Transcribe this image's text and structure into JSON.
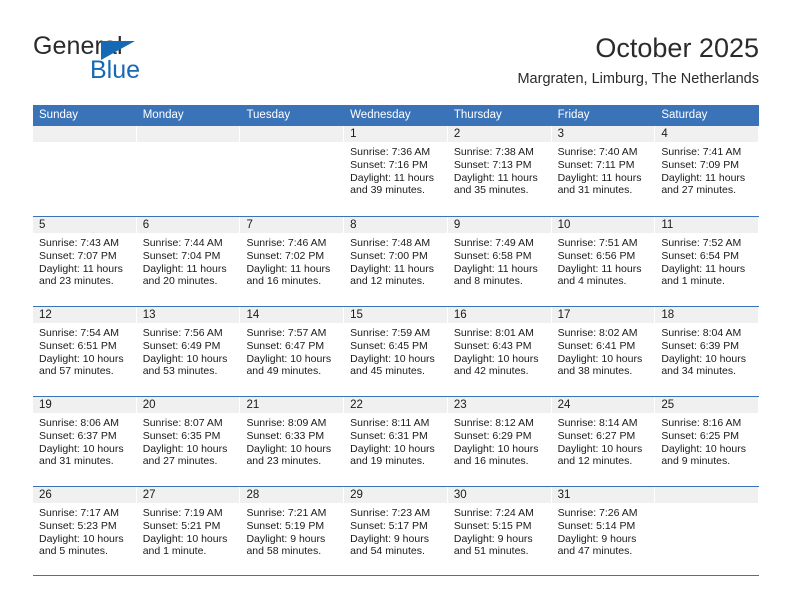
{
  "brand": {
    "word_one": "General",
    "word_two": "Blue",
    "triangle_color": "#1669b5"
  },
  "header": {
    "title": "October 2025",
    "subtitle": "Margraten, Limburg, The Netherlands"
  },
  "theme": {
    "header_blue": "#3b73b9",
    "daynum_band": "#f0f0f0",
    "text": "#1a1a1a"
  },
  "calendar": {
    "weekdays": [
      "Sunday",
      "Monday",
      "Tuesday",
      "Wednesday",
      "Thursday",
      "Friday",
      "Saturday"
    ],
    "weeks": [
      [
        {
          "day": "",
          "sunrise": "",
          "sunset": "",
          "daylight_1": "",
          "daylight_2": ""
        },
        {
          "day": "",
          "sunrise": "",
          "sunset": "",
          "daylight_1": "",
          "daylight_2": ""
        },
        {
          "day": "",
          "sunrise": "",
          "sunset": "",
          "daylight_1": "",
          "daylight_2": ""
        },
        {
          "day": "1",
          "sunrise": "Sunrise: 7:36 AM",
          "sunset": "Sunset: 7:16 PM",
          "daylight_1": "Daylight: 11 hours",
          "daylight_2": "and 39 minutes."
        },
        {
          "day": "2",
          "sunrise": "Sunrise: 7:38 AM",
          "sunset": "Sunset: 7:13 PM",
          "daylight_1": "Daylight: 11 hours",
          "daylight_2": "and 35 minutes."
        },
        {
          "day": "3",
          "sunrise": "Sunrise: 7:40 AM",
          "sunset": "Sunset: 7:11 PM",
          "daylight_1": "Daylight: 11 hours",
          "daylight_2": "and 31 minutes."
        },
        {
          "day": "4",
          "sunrise": "Sunrise: 7:41 AM",
          "sunset": "Sunset: 7:09 PM",
          "daylight_1": "Daylight: 11 hours",
          "daylight_2": "and 27 minutes."
        }
      ],
      [
        {
          "day": "5",
          "sunrise": "Sunrise: 7:43 AM",
          "sunset": "Sunset: 7:07 PM",
          "daylight_1": "Daylight: 11 hours",
          "daylight_2": "and 23 minutes."
        },
        {
          "day": "6",
          "sunrise": "Sunrise: 7:44 AM",
          "sunset": "Sunset: 7:04 PM",
          "daylight_1": "Daylight: 11 hours",
          "daylight_2": "and 20 minutes."
        },
        {
          "day": "7",
          "sunrise": "Sunrise: 7:46 AM",
          "sunset": "Sunset: 7:02 PM",
          "daylight_1": "Daylight: 11 hours",
          "daylight_2": "and 16 minutes."
        },
        {
          "day": "8",
          "sunrise": "Sunrise: 7:48 AM",
          "sunset": "Sunset: 7:00 PM",
          "daylight_1": "Daylight: 11 hours",
          "daylight_2": "and 12 minutes."
        },
        {
          "day": "9",
          "sunrise": "Sunrise: 7:49 AM",
          "sunset": "Sunset: 6:58 PM",
          "daylight_1": "Daylight: 11 hours",
          "daylight_2": "and 8 minutes."
        },
        {
          "day": "10",
          "sunrise": "Sunrise: 7:51 AM",
          "sunset": "Sunset: 6:56 PM",
          "daylight_1": "Daylight: 11 hours",
          "daylight_2": "and 4 minutes."
        },
        {
          "day": "11",
          "sunrise": "Sunrise: 7:52 AM",
          "sunset": "Sunset: 6:54 PM",
          "daylight_1": "Daylight: 11 hours",
          "daylight_2": "and 1 minute."
        }
      ],
      [
        {
          "day": "12",
          "sunrise": "Sunrise: 7:54 AM",
          "sunset": "Sunset: 6:51 PM",
          "daylight_1": "Daylight: 10 hours",
          "daylight_2": "and 57 minutes."
        },
        {
          "day": "13",
          "sunrise": "Sunrise: 7:56 AM",
          "sunset": "Sunset: 6:49 PM",
          "daylight_1": "Daylight: 10 hours",
          "daylight_2": "and 53 minutes."
        },
        {
          "day": "14",
          "sunrise": "Sunrise: 7:57 AM",
          "sunset": "Sunset: 6:47 PM",
          "daylight_1": "Daylight: 10 hours",
          "daylight_2": "and 49 minutes."
        },
        {
          "day": "15",
          "sunrise": "Sunrise: 7:59 AM",
          "sunset": "Sunset: 6:45 PM",
          "daylight_1": "Daylight: 10 hours",
          "daylight_2": "and 45 minutes."
        },
        {
          "day": "16",
          "sunrise": "Sunrise: 8:01 AM",
          "sunset": "Sunset: 6:43 PM",
          "daylight_1": "Daylight: 10 hours",
          "daylight_2": "and 42 minutes."
        },
        {
          "day": "17",
          "sunrise": "Sunrise: 8:02 AM",
          "sunset": "Sunset: 6:41 PM",
          "daylight_1": "Daylight: 10 hours",
          "daylight_2": "and 38 minutes."
        },
        {
          "day": "18",
          "sunrise": "Sunrise: 8:04 AM",
          "sunset": "Sunset: 6:39 PM",
          "daylight_1": "Daylight: 10 hours",
          "daylight_2": "and 34 minutes."
        }
      ],
      [
        {
          "day": "19",
          "sunrise": "Sunrise: 8:06 AM",
          "sunset": "Sunset: 6:37 PM",
          "daylight_1": "Daylight: 10 hours",
          "daylight_2": "and 31 minutes."
        },
        {
          "day": "20",
          "sunrise": "Sunrise: 8:07 AM",
          "sunset": "Sunset: 6:35 PM",
          "daylight_1": "Daylight: 10 hours",
          "daylight_2": "and 27 minutes."
        },
        {
          "day": "21",
          "sunrise": "Sunrise: 8:09 AM",
          "sunset": "Sunset: 6:33 PM",
          "daylight_1": "Daylight: 10 hours",
          "daylight_2": "and 23 minutes."
        },
        {
          "day": "22",
          "sunrise": "Sunrise: 8:11 AM",
          "sunset": "Sunset: 6:31 PM",
          "daylight_1": "Daylight: 10 hours",
          "daylight_2": "and 19 minutes."
        },
        {
          "day": "23",
          "sunrise": "Sunrise: 8:12 AM",
          "sunset": "Sunset: 6:29 PM",
          "daylight_1": "Daylight: 10 hours",
          "daylight_2": "and 16 minutes."
        },
        {
          "day": "24",
          "sunrise": "Sunrise: 8:14 AM",
          "sunset": "Sunset: 6:27 PM",
          "daylight_1": "Daylight: 10 hours",
          "daylight_2": "and 12 minutes."
        },
        {
          "day": "25",
          "sunrise": "Sunrise: 8:16 AM",
          "sunset": "Sunset: 6:25 PM",
          "daylight_1": "Daylight: 10 hours",
          "daylight_2": "and 9 minutes."
        }
      ],
      [
        {
          "day": "26",
          "sunrise": "Sunrise: 7:17 AM",
          "sunset": "Sunset: 5:23 PM",
          "daylight_1": "Daylight: 10 hours",
          "daylight_2": "and 5 minutes."
        },
        {
          "day": "27",
          "sunrise": "Sunrise: 7:19 AM",
          "sunset": "Sunset: 5:21 PM",
          "daylight_1": "Daylight: 10 hours",
          "daylight_2": "and 1 minute."
        },
        {
          "day": "28",
          "sunrise": "Sunrise: 7:21 AM",
          "sunset": "Sunset: 5:19 PM",
          "daylight_1": "Daylight: 9 hours",
          "daylight_2": "and 58 minutes."
        },
        {
          "day": "29",
          "sunrise": "Sunrise: 7:23 AM",
          "sunset": "Sunset: 5:17 PM",
          "daylight_1": "Daylight: 9 hours",
          "daylight_2": "and 54 minutes."
        },
        {
          "day": "30",
          "sunrise": "Sunrise: 7:24 AM",
          "sunset": "Sunset: 5:15 PM",
          "daylight_1": "Daylight: 9 hours",
          "daylight_2": "and 51 minutes."
        },
        {
          "day": "31",
          "sunrise": "Sunrise: 7:26 AM",
          "sunset": "Sunset: 5:14 PM",
          "daylight_1": "Daylight: 9 hours",
          "daylight_2": "and 47 minutes."
        },
        {
          "day": "",
          "sunrise": "",
          "sunset": "",
          "daylight_1": "",
          "daylight_2": ""
        }
      ]
    ]
  }
}
